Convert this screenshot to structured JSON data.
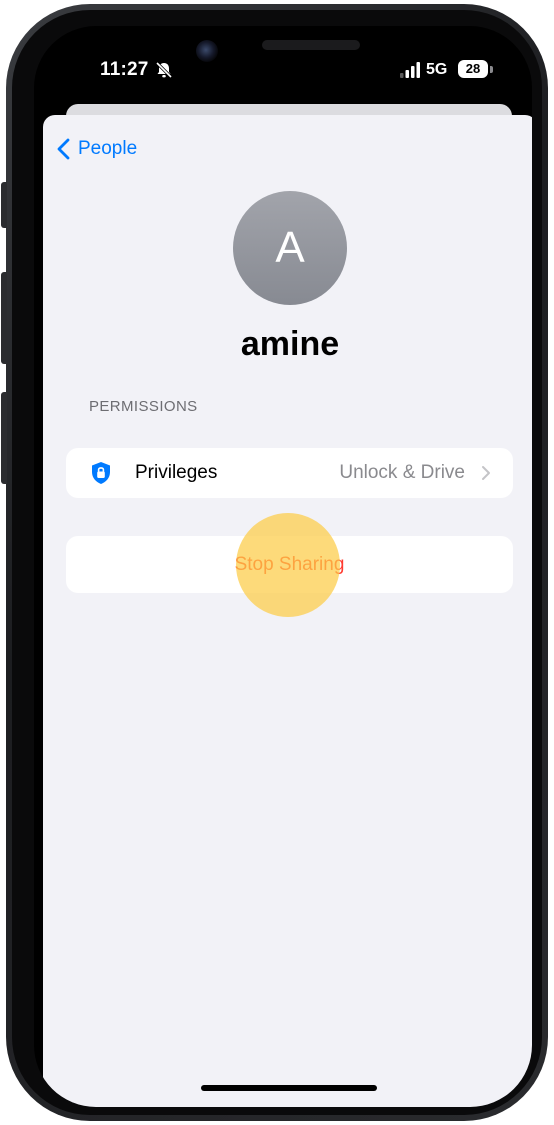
{
  "status_bar": {
    "time": "11:27",
    "network": "5G",
    "battery": "28"
  },
  "nav": {
    "back_label": "People"
  },
  "profile": {
    "initial": "A",
    "name": "amine"
  },
  "permissions": {
    "header": "PERMISSIONS",
    "privileges_label": "Privileges",
    "privileges_value": "Unlock & Drive"
  },
  "actions": {
    "stop_sharing_label": "Stop Sharing"
  },
  "colors": {
    "accent": "#007aff",
    "destructive": "#ff3b30",
    "background": "#f2f2f7",
    "tap_indicator": "#fccc46"
  },
  "icons": {
    "back": "chevron-left-icon",
    "mute": "bell-slash-icon",
    "signal": "cellular-signal-icon",
    "privileges": "shield-lock-icon",
    "disclosure": "chevron-right-icon"
  }
}
